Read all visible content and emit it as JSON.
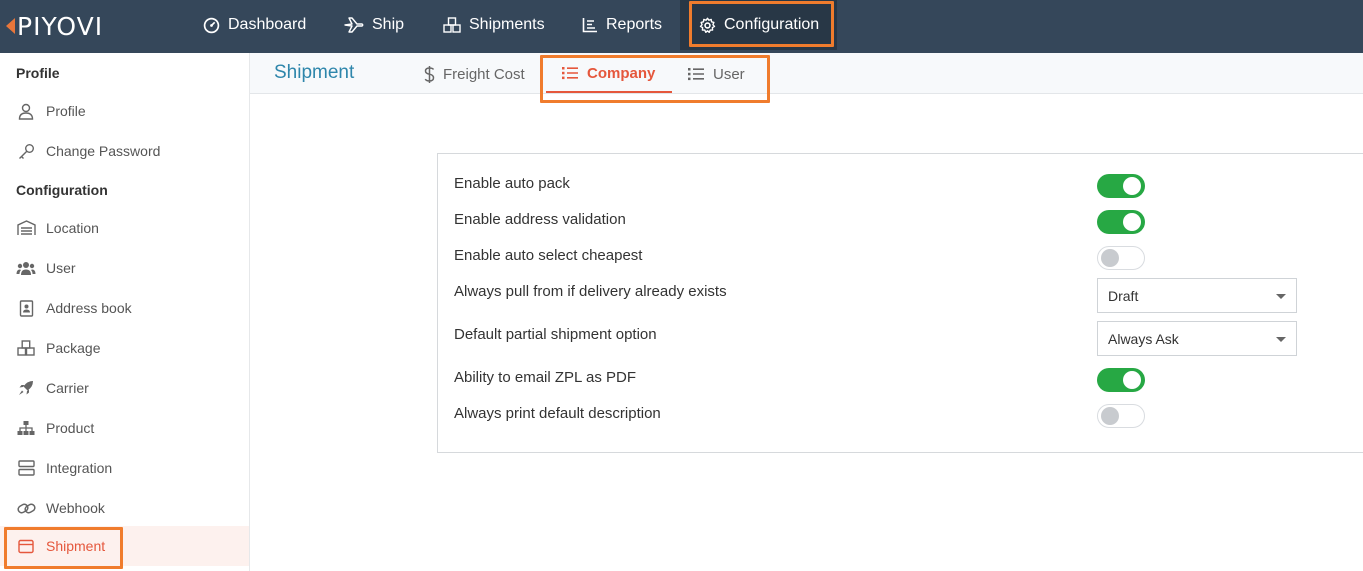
{
  "topnav": {
    "logo": "PIYOVI",
    "items": [
      {
        "label": "Dashboard",
        "icon": "dashboard-icon"
      },
      {
        "label": "Ship",
        "icon": "plane-icon"
      },
      {
        "label": "Shipments",
        "icon": "boxes-icon"
      },
      {
        "label": "Reports",
        "icon": "chart-icon"
      },
      {
        "label": "Configuration",
        "icon": "gear-icon",
        "active": true
      }
    ]
  },
  "sidebar": {
    "profile_heading": "Profile",
    "configuration_heading": "Configuration",
    "items": [
      {
        "label": "Profile",
        "icon": "user-icon"
      },
      {
        "label": "Change Password",
        "icon": "key-icon"
      },
      {
        "label": "Location",
        "icon": "warehouse-icon"
      },
      {
        "label": "User",
        "icon": "users-icon"
      },
      {
        "label": "Address book",
        "icon": "address-book-icon"
      },
      {
        "label": "Package",
        "icon": "package-icon"
      },
      {
        "label": "Carrier",
        "icon": "rocket-icon"
      },
      {
        "label": "Product",
        "icon": "sitemap-icon"
      },
      {
        "label": "Integration",
        "icon": "server-icon"
      },
      {
        "label": "Webhook",
        "icon": "link-icon"
      },
      {
        "label": "Shipment",
        "icon": "box-icon",
        "active": true
      }
    ]
  },
  "tabs": {
    "title": "Shipment",
    "items": [
      {
        "label": "Freight Cost",
        "icon": "dollar-icon"
      },
      {
        "label": "Company",
        "icon": "list-icon",
        "active": true
      },
      {
        "label": "User",
        "icon": "list-icon"
      }
    ]
  },
  "settings": {
    "auto_pack": {
      "label": "Enable auto pack",
      "enabled": true
    },
    "address_validation": {
      "label": "Enable address validation",
      "enabled": true
    },
    "auto_select_cheapest": {
      "label": "Enable auto select cheapest",
      "enabled": false
    },
    "always_pull": {
      "label": "Always pull from if delivery already exists",
      "value": "Draft"
    },
    "partial_shipment": {
      "label": "Default partial shipment option",
      "value": "Always Ask"
    },
    "email_zpl": {
      "label": "Ability to email ZPL as PDF",
      "enabled": true
    },
    "print_description": {
      "label": "Always print default description",
      "enabled": false
    }
  },
  "colors": {
    "topbar": "#35475a",
    "accent": "#e5573c",
    "highlight": "#f07c2d",
    "toggle_on": "#27a844",
    "title": "#2e86ab"
  }
}
